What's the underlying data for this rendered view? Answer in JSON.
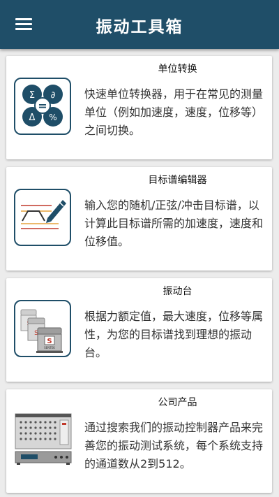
{
  "appbar": {
    "title": "振动工具箱",
    "menu_icon": "hamburger-menu-icon"
  },
  "cards": [
    {
      "title": "单位转换",
      "description": "快速单位转换器，用于在常见的测量单位（例如加速度，速度，位移等）之间切换。",
      "icon": "unit-conversion-icon",
      "icon_symbols": [
        "Σ",
        "∂",
        "Δ",
        "%",
        "="
      ]
    },
    {
      "title": "目标谱编辑器",
      "description": "输入您的随机/正弦/冲击目标谱，以计算此目标谱所需的加速度，速度和位移值。",
      "icon": "spectrum-editor-icon"
    },
    {
      "title": "振动台",
      "description": "根据力额定值，最大速度，位移等属性，为您的目标谱找到理想的振动台。",
      "icon": "shaker-icon",
      "icon_labels": [
        "S",
        "S",
        "S",
        "SENTEK"
      ]
    },
    {
      "title": "公司产品",
      "description": "通过搜索我们的振动控制器产品来完善您的振动测试系统，每个系统支持的通道数从2到512。",
      "icon": "vibration-controller-icon"
    }
  ],
  "colors": {
    "appbar": "#1f4e68",
    "accent_icon": "#1f4e68",
    "red": "#c0392b"
  }
}
